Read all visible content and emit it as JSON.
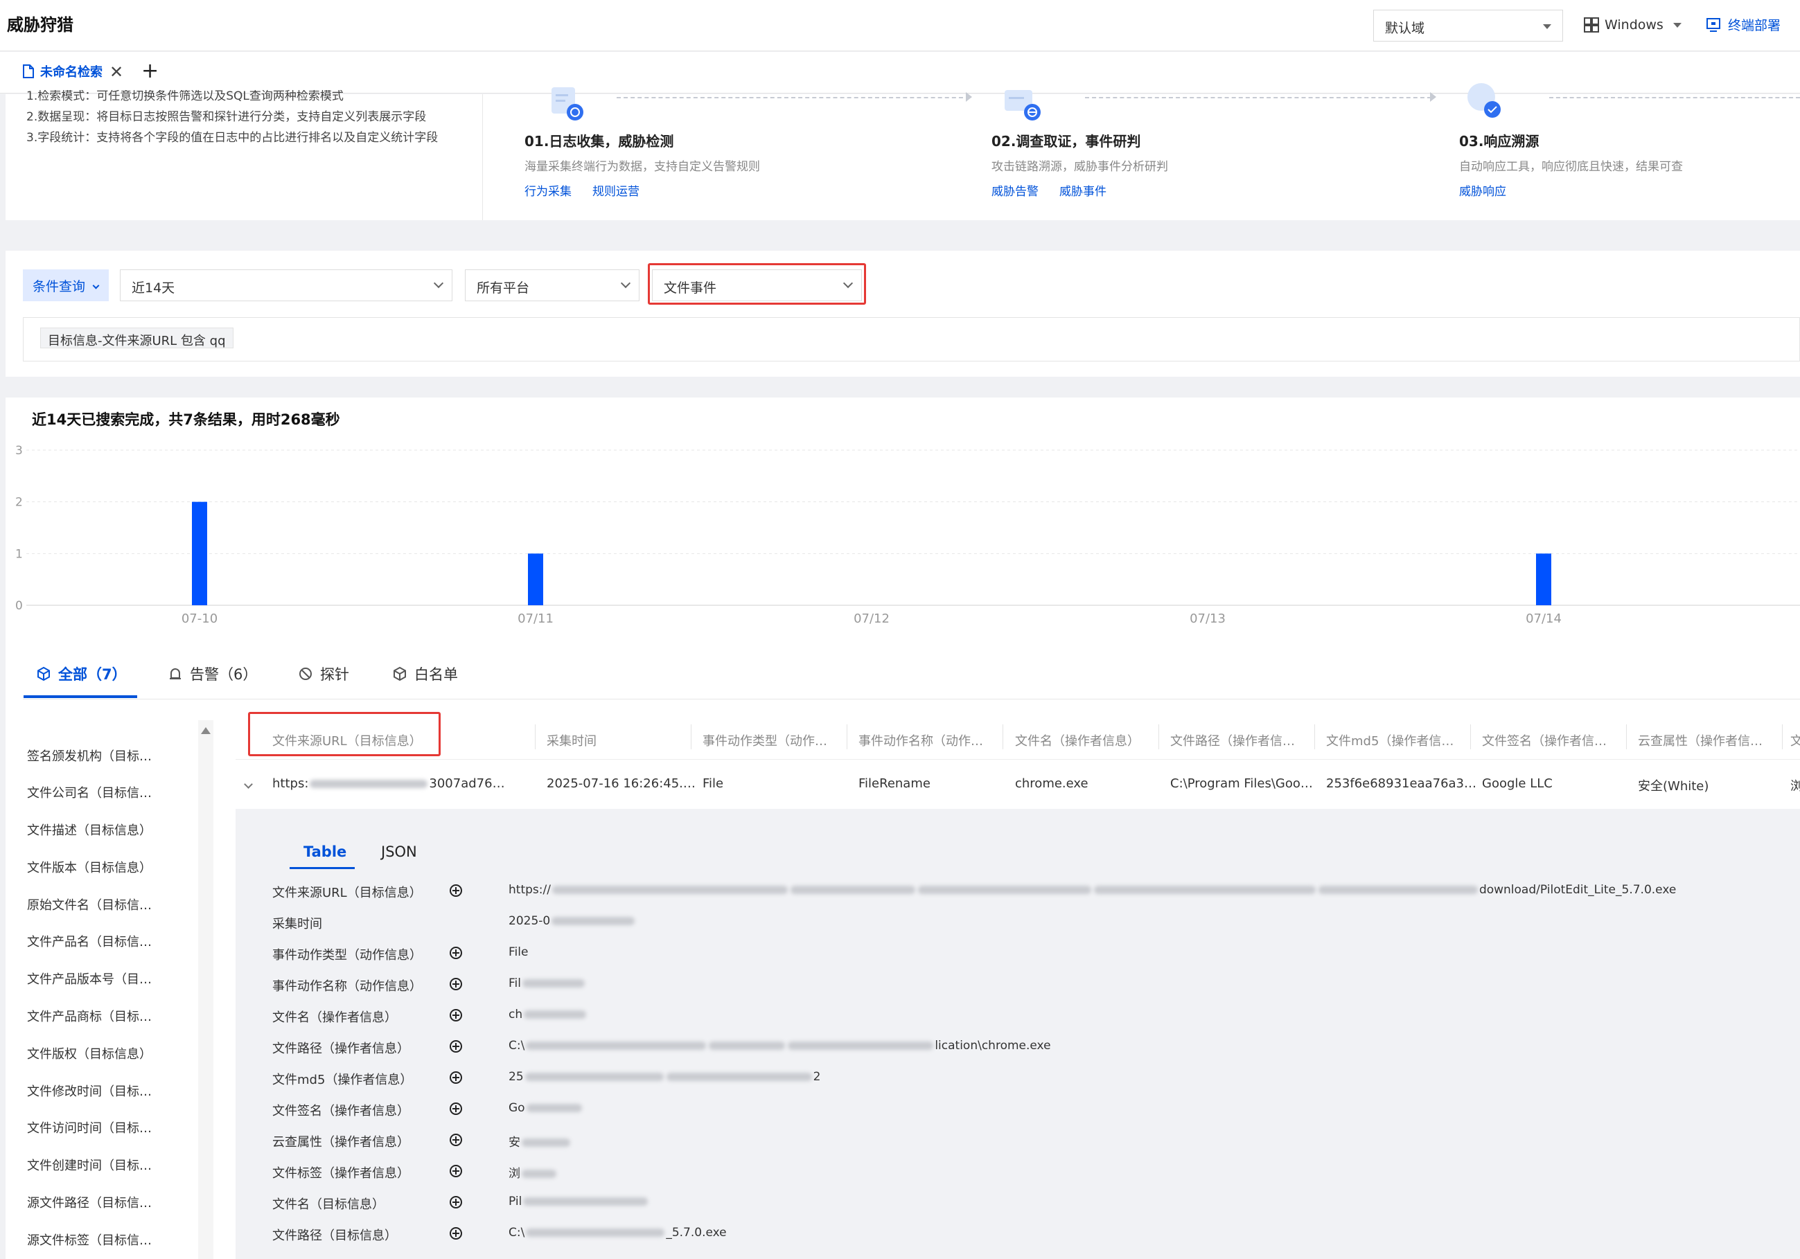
{
  "app": {
    "title": "威胁狩猎"
  },
  "header": {
    "domain_select": "默认域",
    "os_select": "Windows",
    "deploy_link": "终端部署"
  },
  "tabs": {
    "current": "未命名检索",
    "close_symbol": "✕",
    "add_symbol": "+"
  },
  "intro": {
    "lines": [
      "1.检索模式：可任意切换条件筛选以及SQL查询两种检索模式",
      "2.数据呈现：将目标日志按照告警和探针进行分类，支持自定义列表展示字段",
      "3.字段统计：支持将各个字段的值在日志中的占比进行排名以及自定义统计字段"
    ],
    "steps": [
      {
        "title": "01.日志收集，威胁检测",
        "desc": "海量采集终端行为数据，支持自定义告警规则",
        "links": [
          "行为采集",
          "规则运营"
        ]
      },
      {
        "title": "02.调查取证，事件研判",
        "desc": "攻击链路溯源，威胁事件分析研判",
        "links": [
          "威胁告警",
          "威胁事件"
        ]
      },
      {
        "title": "03.响应溯源",
        "desc": "自动响应工具，响应彻底且快速，结果可查",
        "links": [
          "威胁响应"
        ]
      }
    ]
  },
  "filters": {
    "condition_button": "条件查询",
    "time_range": "近14天",
    "platform": "所有平台",
    "event_type": "文件事件",
    "condition_tag": "目标信息-文件来源URL 包含 qq"
  },
  "result": {
    "summary": "近14天已搜索完成，共7条结果，用时268毫秒"
  },
  "chart_data": {
    "type": "bar",
    "categories": [
      "07-10",
      "07/11",
      "07/12",
      "07/13",
      "07/14"
    ],
    "values": [
      2,
      1,
      0,
      0,
      1
    ],
    "y_ticks": [
      "3",
      "2",
      "1",
      "0"
    ],
    "ylim": [
      0,
      3
    ],
    "grid": true,
    "colors": {
      "bar": "#0052ff"
    }
  },
  "result_tabs": [
    {
      "label": "全部（7）",
      "icon": "cube-icon"
    },
    {
      "label": "告警（6）",
      "icon": "alarm-icon"
    },
    {
      "label": "探针",
      "icon": "probe-icon"
    },
    {
      "label": "白名单",
      "icon": "whitelist-icon"
    }
  ],
  "field_list": [
    "签名颁发机构（目标…",
    "文件公司名（目标信…",
    "文件描述（目标信息）",
    "文件版本（目标信息）",
    "原始文件名（目标信…",
    "文件产品名（目标信…",
    "文件产品版本号（目…",
    "文件产品商标（目标…",
    "文件版权（目标信息）",
    "文件修改时间（目标…",
    "文件访问时间（目标…",
    "文件创建时间（目标…",
    "源文件路径（目标信…",
    "源文件标签（目标信…"
  ],
  "table": {
    "headers": [
      "文件来源URL（目标信息）",
      "采集时间",
      "事件动作类型（动作…",
      "事件动作名称（动作…",
      "文件名（操作者信息）",
      "文件路径（操作者信…",
      "文件md5（操作者信…",
      "文件签名（操作者信…",
      "云查属性（操作者信…",
      "文"
    ],
    "row": [
      "https:",
      "3007ad76…",
      "2025-07-16 16:26:45.…",
      "File",
      "FileRename",
      "chrome.exe",
      "C:\\Program Files\\Goo…",
      "253f6e68931eaa76a3…",
      "Google LLC",
      "安全(White)",
      "浏"
    ]
  },
  "detail": {
    "tabs": [
      "Table",
      "JSON"
    ],
    "rows": [
      {
        "key": "文件来源URL（目标信息）",
        "plus": true,
        "prefix": "https://",
        "suffix": "download/PilotEdit_Lite_5.7.0.exe"
      },
      {
        "key": "采集时间",
        "plus": false,
        "prefix": "2025-0",
        "suffix": ""
      },
      {
        "key": "事件动作类型（动作信息）",
        "plus": true,
        "prefix": "File",
        "suffix": ""
      },
      {
        "key": "事件动作名称（动作信息）",
        "plus": true,
        "prefix": "Fil",
        "suffix": ""
      },
      {
        "key": "文件名（操作者信息）",
        "plus": true,
        "prefix": "ch",
        "suffix": ""
      },
      {
        "key": "文件路径（操作者信息）",
        "plus": true,
        "prefix": "C:\\",
        "suffix": "lication\\chrome.exe"
      },
      {
        "key": "文件md5（操作者信息）",
        "plus": true,
        "prefix": "25",
        "suffix": "2"
      },
      {
        "key": "文件签名（操作者信息）",
        "plus": true,
        "prefix": "Go",
        "suffix": ""
      },
      {
        "key": "云查属性（操作者信息）",
        "plus": true,
        "prefix": "安",
        "suffix": ""
      },
      {
        "key": "文件标签（操作者信息）",
        "plus": true,
        "prefix": "浏",
        "suffix": ""
      },
      {
        "key": "文件名（目标信息）",
        "plus": true,
        "prefix": "Pil",
        "suffix": ""
      },
      {
        "key": "文件路径（目标信息）",
        "plus": true,
        "prefix": "C:\\",
        "suffix": "_5.7.0.exe"
      }
    ]
  }
}
